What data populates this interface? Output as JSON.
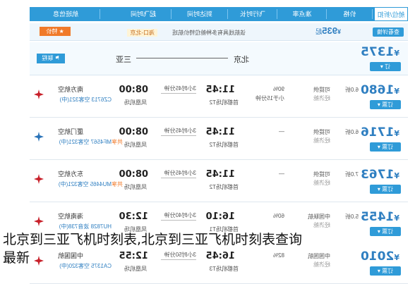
{
  "header": {
    "tabs": [
      "航班信息",
      "起飞时间",
      "到达时间",
      "飞行时长",
      "准点率",
      "价格",
      "舱位/折扣"
    ]
  },
  "summary": {
    "price_prefix": "¥",
    "price": "935",
    "price_suffix": "起",
    "route": "海口-北京",
    "special_badge": "特价",
    "special_text": "该航线具有多种舱位特价航班",
    "book_label": "查看详情"
  },
  "route_banner": {
    "tag": "联程",
    "from": "三亚",
    "to": "北京",
    "price_prefix": "¥",
    "price": "1375"
  },
  "flights": [
    {
      "airline": "南方航空",
      "flight_no": "CZ6713 空客321(中)",
      "airline_color": "#c8202a",
      "dep_time": "08:00",
      "dep_airport": "凤凰机场",
      "duration": "3小时45分钟",
      "arr_time": "11:45",
      "arr_airport": "首都机场T2",
      "punctuality": "90%",
      "punctuality_sub": "小于15分钟",
      "meal": "可提供",
      "cabin_code": "经济舱",
      "discount": "6.0折",
      "price_prefix": "¥",
      "price": "1680",
      "book_label": "订票",
      "tag": ""
    },
    {
      "airline": "厦门航空",
      "flight_no": "MF4567 空客321(中)",
      "airline_color": "#2a73b8",
      "dep_time": "08:00",
      "dep_airport": "凤凰机场",
      "duration": "3小时45分钟",
      "arr_time": "11:45",
      "arr_airport": "首都机场T2",
      "punctuality": "—",
      "punctuality_sub": "",
      "meal": "可提供",
      "cabin_code": "经济舱",
      "discount": "6.0折",
      "price_prefix": "¥",
      "price": "1716",
      "book_label": "订票",
      "tag": "共享"
    },
    {
      "airline": "东方航空",
      "flight_no": "MU4465 空客321(中)",
      "airline_color": "#c8202a",
      "dep_time": "08:00",
      "dep_airport": "凤凰机场",
      "duration": "3小时45分钟",
      "arr_time": "11:45",
      "arr_airport": "首都机场T2",
      "punctuality": "—",
      "punctuality_sub": "",
      "meal": "可提供",
      "cabin_code": "经济舱",
      "discount": "7.0折",
      "price_prefix": "¥",
      "price": "1763",
      "book_label": "订票",
      "tag": "共享"
    },
    {
      "airline": "海南航空",
      "flight_no": "HU7828 波音738(中)",
      "airline_color": "#c8202a",
      "dep_time": "12:30",
      "dep_airport": "凤凰机场",
      "duration": "3小时40分钟",
      "arr_time": "16:10",
      "arr_airport": "首都机场T1",
      "punctuality": "60%",
      "punctuality_sub": "",
      "meal": "中国联航",
      "cabin_code": "经济舱",
      "discount": "5.0折",
      "price_prefix": "¥",
      "price": "1455",
      "book_label": "订票",
      "tag": ""
    },
    {
      "airline": "中国国航",
      "flight_no": "CA1375 空客320(中)",
      "airline_color": "#c8202a",
      "dep_time": "12:55",
      "dep_airport": "凤凰机场",
      "duration": "3小时50分钟",
      "arr_time": "16:45",
      "arr_airport": "首都机场T3",
      "punctuality": "82%",
      "punctuality_sub": "",
      "meal": "中国国航",
      "cabin_code": "经济舱",
      "discount": "",
      "price_prefix": "¥",
      "price": "2010",
      "book_label": "订票",
      "tag": ""
    }
  ],
  "caption": {
    "line1": "北京到三亚飞机时刻表,北京到三亚飞机时刻表查询",
    "line2": "最新"
  }
}
